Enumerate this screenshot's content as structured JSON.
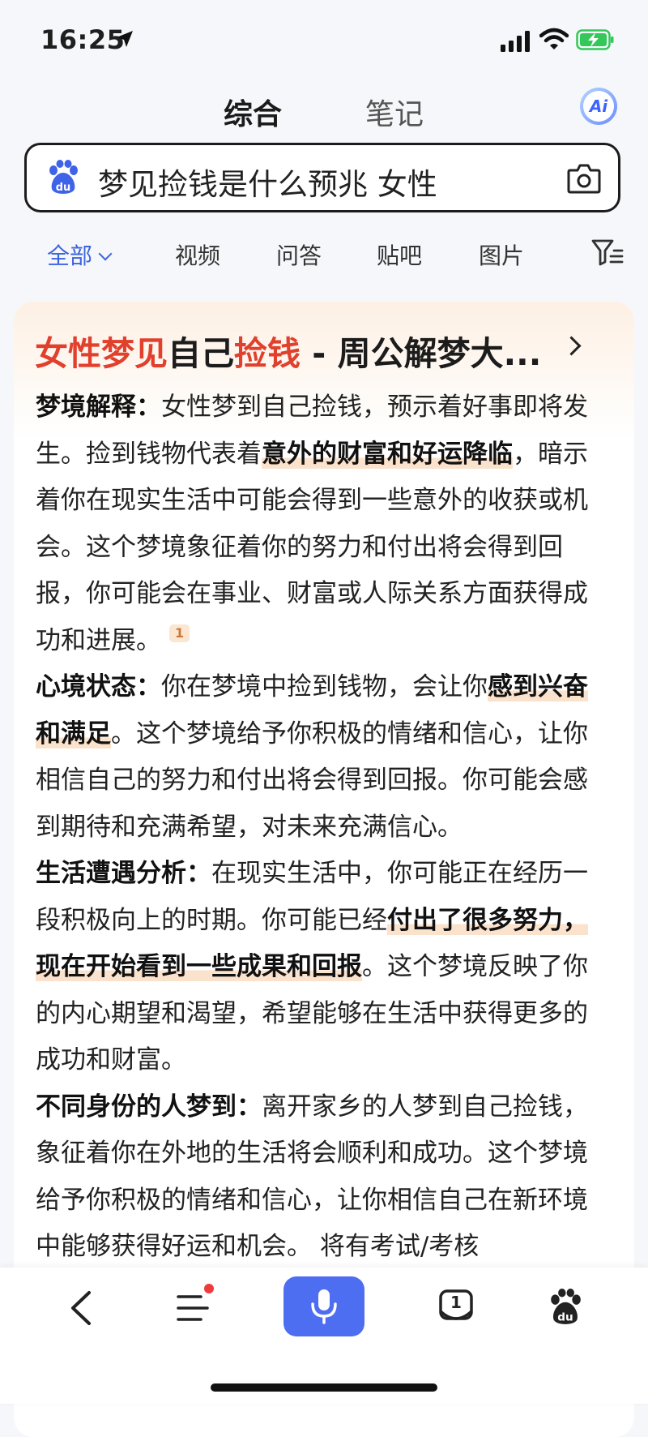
{
  "status_bar": {
    "time": "16:25"
  },
  "top_tabs": [
    {
      "label": "综合",
      "active": true
    },
    {
      "label": "笔记",
      "active": false
    }
  ],
  "ai_button": {
    "label": "Ai"
  },
  "search": {
    "query": "梦见捡钱是什么预兆 女性"
  },
  "filters": [
    {
      "label": "全部",
      "active": true
    },
    {
      "label": "视频"
    },
    {
      "label": "问答"
    },
    {
      "label": "贴吧"
    },
    {
      "label": "图片"
    }
  ],
  "card": {
    "title_parts": [
      "女性梦见",
      "自己",
      "捡钱",
      " - 周公解梦大..."
    ],
    "sections": [
      {
        "heading": "梦境解释：",
        "text1": "女性梦到自己捡钱，预示着好事即将发生。捡到钱物代表着",
        "highlight": "意外的财富和好运降临",
        "text2": "，暗示着你在现实生活中可能会得到一些意外的收获或机会。这个梦境象征着你的努力和付出将会得到回报，你可能会在事业、财富或人际关系方面获得成功和进展。",
        "ref": "1"
      },
      {
        "heading": "心境状态：",
        "text1": "你在梦境中捡到钱物，会让你",
        "highlight": "感到兴奋和满足",
        "text2": "。这个梦境给予你积极的情绪和信心，让你相信自己的努力和付出将会得到回报。你可能会感到期待和充满希望，对未来充满信心。"
      },
      {
        "heading": "生活遭遇分析：",
        "text1": "在现实生活中，你可能正在经历一段积极向上的时期。你可能已经",
        "highlight": "付出了很多努力，现在开始看到一些成果和回报",
        "text2": "。这个梦境反映了你的内心期望和渴望，希望能够在生活中获得更多的成功和财富。"
      },
      {
        "heading": "不同身份的人梦到：",
        "text1": "离开家乡的人梦到自己捡钱，象征着你在外地的生活将会顺利和成功。这个梦境给予你积极的情绪和信心，让你相信自己在新环境中能够获得好运和机会。 将有考试/考核",
        "highlight": "",
        "text2": ""
      }
    ]
  },
  "bottom_bar": {
    "tabs_count": "1",
    "items": [
      "back",
      "menu",
      "voice",
      "tabs",
      "baidu-home"
    ]
  },
  "colors": {
    "accent": "#4e6ef2",
    "title_red": "#e0402c",
    "highlight": "#fbe2cc"
  }
}
